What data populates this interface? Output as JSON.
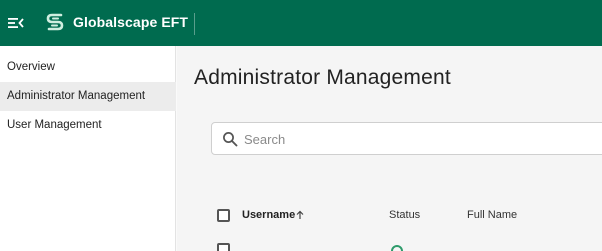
{
  "header": {
    "brand_name": "Globalscape EFT",
    "colors": {
      "topbar": "#006b4f",
      "brand_text": "#ffffff"
    }
  },
  "sidebar": {
    "items": [
      {
        "label": "Overview",
        "active": false
      },
      {
        "label": "Administrator Management",
        "active": true
      },
      {
        "label": "User Management",
        "active": false
      }
    ]
  },
  "main": {
    "page_title": "Administrator Management",
    "search": {
      "placeholder": "Search",
      "value": ""
    },
    "table": {
      "columns": [
        {
          "label": "Username",
          "sorted": "ascending"
        },
        {
          "label": "Status"
        },
        {
          "label": "Full Name"
        }
      ]
    }
  },
  "icons": {
    "menu": "menu-collapse-icon",
    "logo": "globalscape-logo-icon",
    "search": "search-icon",
    "sort": "arrow-up-icon"
  }
}
